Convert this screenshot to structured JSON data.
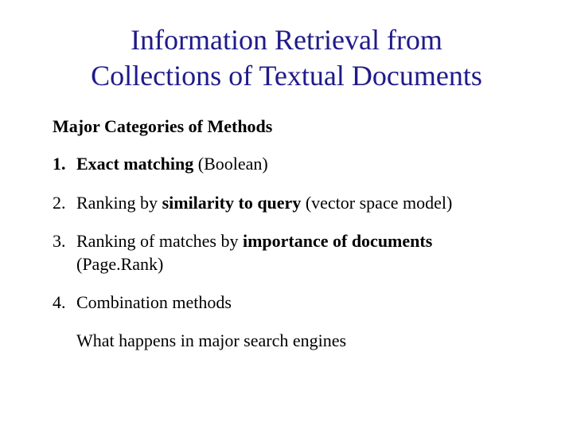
{
  "title_line1": "Information Retrieval from",
  "title_line2": "Collections of Textual Documents",
  "subtitle": "Major Categories of Methods",
  "items": {
    "0": {
      "num": "1.",
      "b1": "Exact matching",
      "t1": " (Boolean)"
    },
    "1": {
      "num": "2.",
      "t0": "Ranking by ",
      "b1": "similarity to query",
      "t1": " (vector space model)"
    },
    "2": {
      "num": "3.",
      "t0": "Ranking of matches by ",
      "b1": "importance of documents",
      "t1_br": "(Page.Rank)"
    },
    "3": {
      "num": "4.",
      "t0": "Combination methods"
    }
  },
  "trail": "What happens in major search engines"
}
